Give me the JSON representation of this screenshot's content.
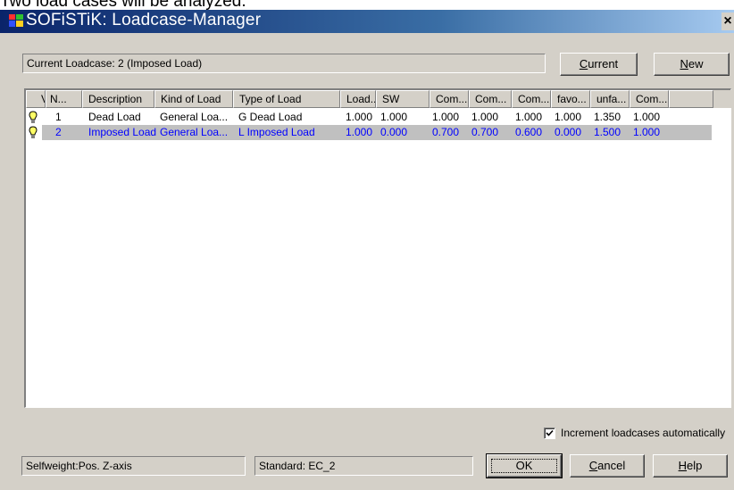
{
  "caption": "Two load cases will be analyzed.",
  "window": {
    "title": "SOFiSTiK: Loadcase-Manager",
    "close_glyph": "×"
  },
  "current_field": "Current Loadcase: 2 (Imposed Load)",
  "buttons": {
    "current": {
      "pre": "",
      "key": "C",
      "post": "urrent"
    },
    "new": {
      "pre": "",
      "key": "N",
      "post": "ew"
    },
    "ok": {
      "pre": "",
      "key": "",
      "post": "OK"
    },
    "cancel": {
      "pre": "",
      "key": "C",
      "post": "ancel"
    },
    "help": {
      "pre": "",
      "key": "H",
      "post": "elp"
    }
  },
  "table": {
    "columns": [
      "V",
      "N...",
      "Description",
      "Kind of Load",
      "Type of Load",
      "Load...",
      "SW",
      "Com...",
      "Com...",
      "Com...",
      "favo...",
      "unfa...",
      "Com..."
    ],
    "rows": [
      {
        "num": "1",
        "description": "Dead Load",
        "kind": "General Loa...",
        "type": "G Dead Load",
        "load": "1.000",
        "sw": "1.000",
        "com1": "1.000",
        "com2": "1.000",
        "com3": "1.000",
        "favo": "1.000",
        "unfa": "1.350",
        "com4": "1.000",
        "selected": false,
        "text_color": "#000000"
      },
      {
        "num": "2",
        "description": "Imposed Load",
        "kind": "General Loa...",
        "type": "L Imposed Load",
        "load": "1.000",
        "sw": "0.000",
        "com1": "0.700",
        "com2": "0.700",
        "com3": "0.600",
        "favo": "0.000",
        "unfa": "1.500",
        "com4": "1.000",
        "selected": true,
        "text_color": "#0000ff"
      }
    ]
  },
  "checkbox": {
    "label": "Increment loadcases automatically",
    "checked": true
  },
  "status": {
    "selfweight": "Selfweight:Pos. Z-axis",
    "standard": "Standard: EC_2"
  },
  "colors": {
    "title_start": "#0a246a",
    "title_end": "#a6caf0",
    "dialog_bg": "#d4d0c8",
    "selected_row_bg": "#c0c0c0",
    "selected_text": "#0000ff",
    "bulb": "#ffff66"
  },
  "icons": {
    "app": "sofistik-app-icon",
    "row_status": "lightbulb-icon",
    "close": "close-icon"
  }
}
